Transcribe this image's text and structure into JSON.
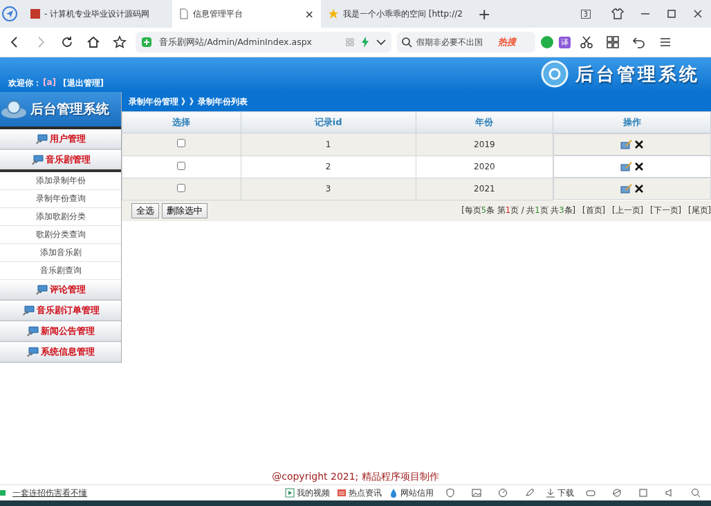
{
  "browser": {
    "tabs": [
      {
        "title": "- 计算机专业毕业设计源码网",
        "selected": false
      },
      {
        "title": "信息管理平台",
        "selected": true,
        "close": "×"
      },
      {
        "title": "我是一个小乖乖的空间 [http://2",
        "selected": false
      }
    ],
    "new_tab": "+",
    "tab_count": "3",
    "address": "音乐剧网站/Admin/AdminIndex.aspx",
    "search_placeholder": "假期非必要不出国",
    "hot": "热搜",
    "translate": "译"
  },
  "header": {
    "welcome": "欢迎你：",
    "user": "[a]",
    "logout": "[退出管理]",
    "title": "后台管理系统"
  },
  "sidebar": {
    "logo_title": "后台管理系统",
    "groups": [
      {
        "label": "用户管理",
        "expanded": false
      },
      {
        "label": "音乐剧管理",
        "expanded": true,
        "children": [
          {
            "label": "添加录制年份"
          },
          {
            "label": "录制年份查询"
          },
          {
            "label": "添加歌剧分类"
          },
          {
            "label": "歌剧分类查询"
          },
          {
            "label": "添加音乐剧"
          },
          {
            "label": "音乐剧查询"
          }
        ]
      },
      {
        "label": "评论管理",
        "expanded": false
      },
      {
        "label": "音乐剧订单管理",
        "expanded": false
      },
      {
        "label": "新闻公告管理",
        "expanded": false
      },
      {
        "label": "系统信息管理",
        "expanded": false
      }
    ]
  },
  "breadcrumb": "录制年份管理 》》录制年份列表",
  "table": {
    "columns": [
      "选择",
      "记录id",
      "年份",
      "操作"
    ],
    "rows": [
      {
        "id": "1",
        "year": "2019",
        "checked": false
      },
      {
        "id": "2",
        "year": "2020",
        "checked": false
      },
      {
        "id": "3",
        "year": "2021",
        "checked": false
      }
    ]
  },
  "buttons": [
    "全选",
    "删除选中"
  ],
  "pager": {
    "summary": [
      {
        "text": "[每页"
      },
      {
        "text": "5",
        "color": "#2e8b2e"
      },
      {
        "text": "条 第"
      },
      {
        "text": "1",
        "color": "#cc2222"
      },
      {
        "text": "页 / 共"
      },
      {
        "text": "1",
        "color": "#2e8b2e"
      },
      {
        "text": "页 共"
      },
      {
        "text": "3",
        "color": "#2e8b2e"
      },
      {
        "text": "条]"
      }
    ],
    "links": [
      "[首页]",
      "[上一页]",
      "[下一页]",
      "[尾页]"
    ]
  },
  "footer": "@copyright 2021; 精品程序项目制作",
  "status_bar": {
    "left": "一套连招伤害看不懂",
    "items": [
      {
        "label": "我的视频",
        "kind": "video"
      },
      {
        "label": "热点资讯",
        "kind": "news"
      },
      {
        "label": "网站信用",
        "kind": "drop"
      }
    ],
    "download": "下载"
  }
}
